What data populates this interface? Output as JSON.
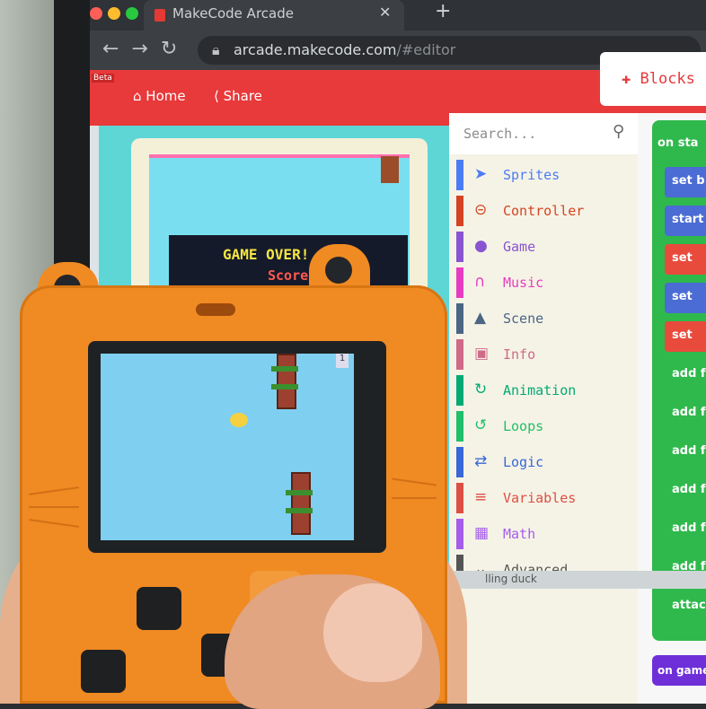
{
  "browser": {
    "tab_title": "MakeCode Arcade",
    "tab_close": "✕",
    "new_tab": "+",
    "nav_icons": "←→↻",
    "url_host": "arcade.makecode.com",
    "url_path": "/#editor"
  },
  "header": {
    "beta": "Beta",
    "home_label": "Home",
    "share_label": "Share",
    "blocks_label": "Blocks"
  },
  "simulator": {
    "game_over": "GAME OVER!",
    "score_text": "Score"
  },
  "toolbox": {
    "search_placeholder": "Search...",
    "categories": [
      {
        "label": "Sprites",
        "icon": "paper-plane-icon",
        "color": "#4b7cf3"
      },
      {
        "label": "Controller",
        "icon": "gamepad-icon",
        "color": "#d54322"
      },
      {
        "label": "Game",
        "icon": "circle-icon",
        "color": "#8854d0"
      },
      {
        "label": "Music",
        "icon": "headphones-icon",
        "color": "#e63cc1"
      },
      {
        "label": "Scene",
        "icon": "tree-icon",
        "color": "#4b6584"
      },
      {
        "label": "Info",
        "icon": "id-card-icon",
        "color": "#cf6a87"
      },
      {
        "label": "Animation",
        "icon": "refresh-icon",
        "color": "#03aa74"
      },
      {
        "label": "Loops",
        "icon": "loop-icon",
        "color": "#20bf6b"
      },
      {
        "label": "Logic",
        "icon": "shuffle-icon",
        "color": "#3867d6"
      },
      {
        "label": "Variables",
        "icon": "list-icon",
        "color": "#dd4f44"
      },
      {
        "label": "Math",
        "icon": "calculator-icon",
        "color": "#a55eea"
      },
      {
        "label": "Advanced",
        "icon": "chevron-down-icon",
        "color": "#555555"
      }
    ]
  },
  "workspace": {
    "on_start": "on sta",
    "blocks": [
      {
        "label": "set b",
        "color": "#4a6cd4"
      },
      {
        "label": "start",
        "color": "#4a6cd4"
      },
      {
        "label": "set",
        "color": "#e84b3c"
      },
      {
        "label": "set",
        "color": "#4a6cd4"
      },
      {
        "label": "set",
        "color": "#e84b3c"
      },
      {
        "label": "add fr",
        "color": "#2fb94c"
      },
      {
        "label": "add fr",
        "color": "#2fb94c"
      },
      {
        "label": "add fr",
        "color": "#2fb94c"
      },
      {
        "label": "add fr",
        "color": "#2fb94c"
      },
      {
        "label": "add fr",
        "color": "#2fb94c"
      },
      {
        "label": "add fr",
        "color": "#2fb94c"
      },
      {
        "label": "attach",
        "color": "#2fb94c"
      }
    ],
    "on_game": "on game",
    "bottom_text": "lling duck"
  },
  "device": {
    "lcd_score": "1"
  }
}
